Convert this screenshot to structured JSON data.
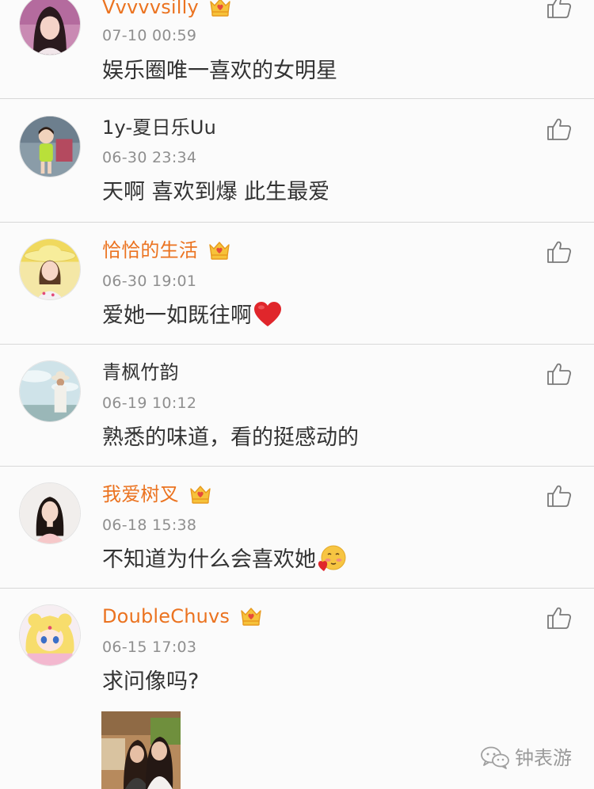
{
  "comments": [
    {
      "username": "Vvvvvsilly",
      "vip": true,
      "time": "07-10 00:59",
      "text": "娱乐圈唯一喜欢的女明星",
      "avatar_icon": "avatar-girl-portrait"
    },
    {
      "username": "1y-夏日乐Uu",
      "vip": false,
      "time": "06-30 23:34",
      "text": "天啊 喜欢到爆 此生最爱",
      "avatar_icon": "avatar-child-photo"
    },
    {
      "username": "恰恰的生活",
      "vip": true,
      "time": "06-30 19:01",
      "text": "爱她一如既往啊",
      "emoji": "red-heart",
      "avatar_icon": "avatar-woman-sun-hat"
    },
    {
      "username": "青枫竹韵",
      "vip": false,
      "time": "06-19 10:12",
      "text": "熟悉的味道，看的挺感动的",
      "avatar_icon": "avatar-person-sky"
    },
    {
      "username": "我爱树叉",
      "vip": true,
      "time": "06-18 15:38",
      "text": "不知道为什么会喜欢她",
      "emoji": "blushing-heart-face",
      "avatar_icon": "avatar-woman-portrait"
    },
    {
      "username": "DoubleChuvs",
      "vip": true,
      "time": "06-15 17:03",
      "text": "求问像吗?",
      "avatar_icon": "avatar-anime-sailor-moon",
      "attachment_icon": "photo-thumbnail"
    }
  ],
  "watermark": {
    "text": "钟表游",
    "icon": "wechat-icon"
  },
  "colors": {
    "vip_username": "#eb7320",
    "normal_username": "#333333",
    "timestamp": "#8f8f8f",
    "divider": "#d8d8d8",
    "background": "#fbfbfb"
  }
}
